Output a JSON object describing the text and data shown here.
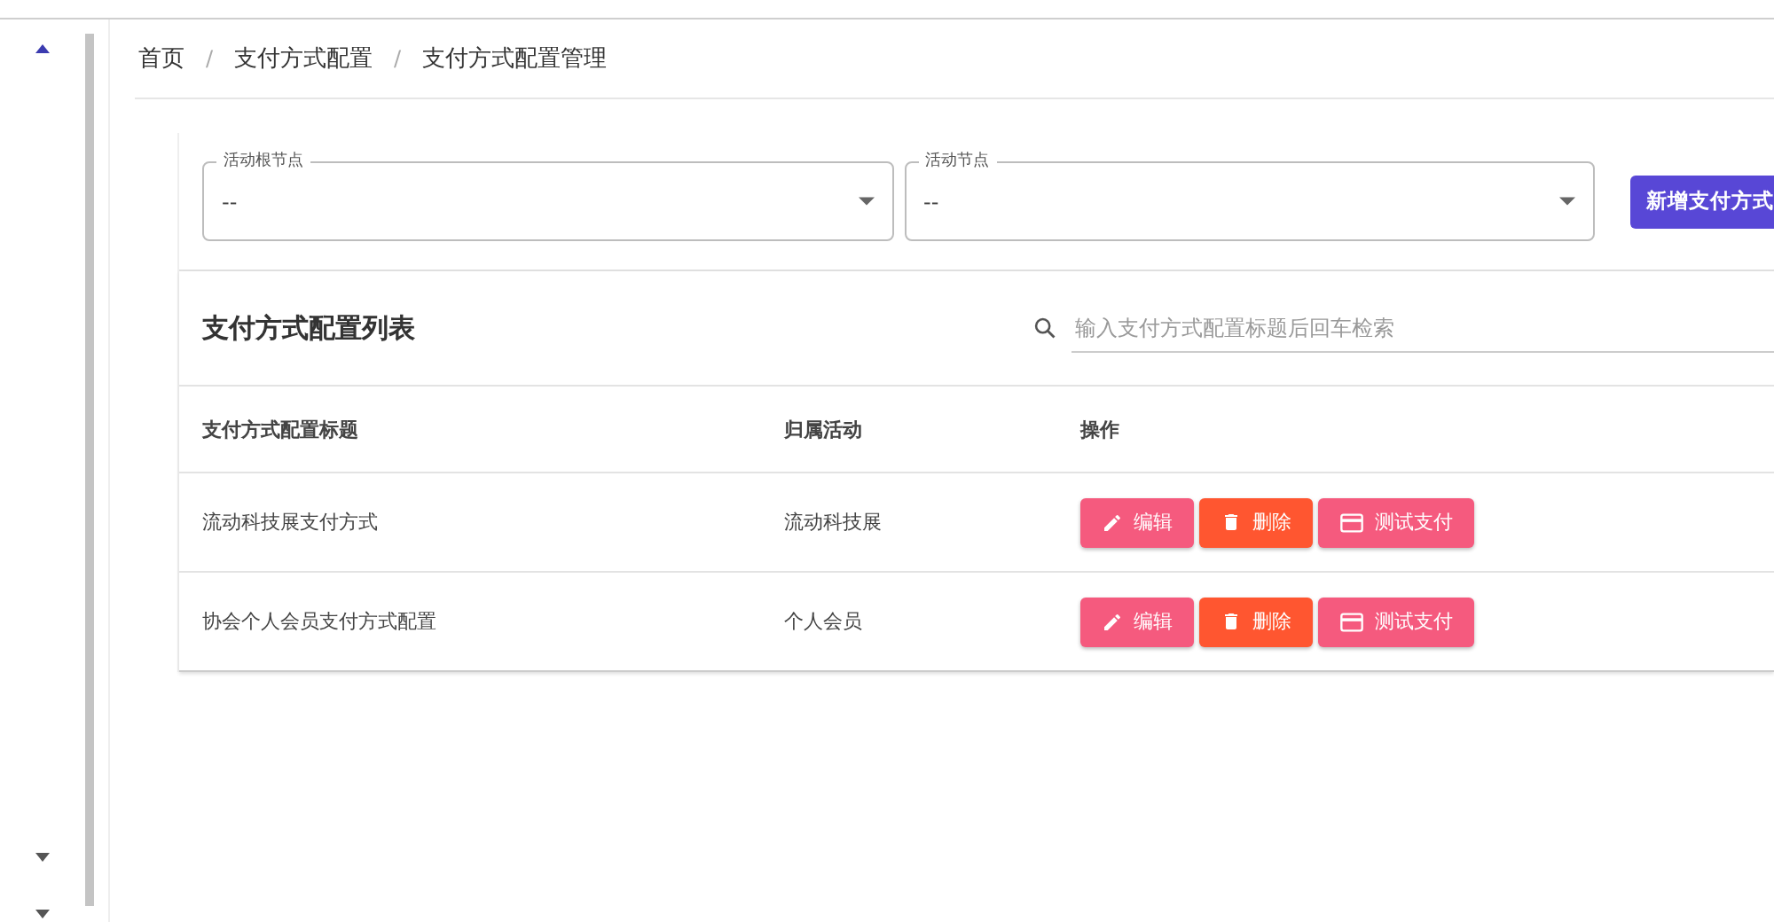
{
  "breadcrumb": {
    "items": [
      "首页",
      "支付方式配置",
      "支付方式配置管理"
    ],
    "separator": "/"
  },
  "filters": [
    {
      "label": "活动根节点",
      "value": "--"
    },
    {
      "label": "活动节点",
      "value": "--"
    }
  ],
  "add_button": "新增支付方式",
  "list": {
    "title": "支付方式配置列表",
    "search": {
      "placeholder": "输入支付方式配置标题后回车检索"
    },
    "columns": [
      "支付方式配置标题",
      "归属活动",
      "操作"
    ],
    "rows": [
      {
        "title": "流动科技展支付方式",
        "activity": "流动科技展",
        "actions": [
          {
            "kind": "edit",
            "label": "编辑"
          },
          {
            "kind": "delete",
            "label": "删除"
          },
          {
            "kind": "pay",
            "label": "测试支付"
          }
        ]
      },
      {
        "title": "协会个人会员支付方式配置",
        "activity": "个人会员",
        "actions": [
          {
            "kind": "edit",
            "label": "编辑"
          },
          {
            "kind": "delete",
            "label": "删除"
          },
          {
            "kind": "pay",
            "label": "测试支付"
          }
        ]
      }
    ]
  }
}
